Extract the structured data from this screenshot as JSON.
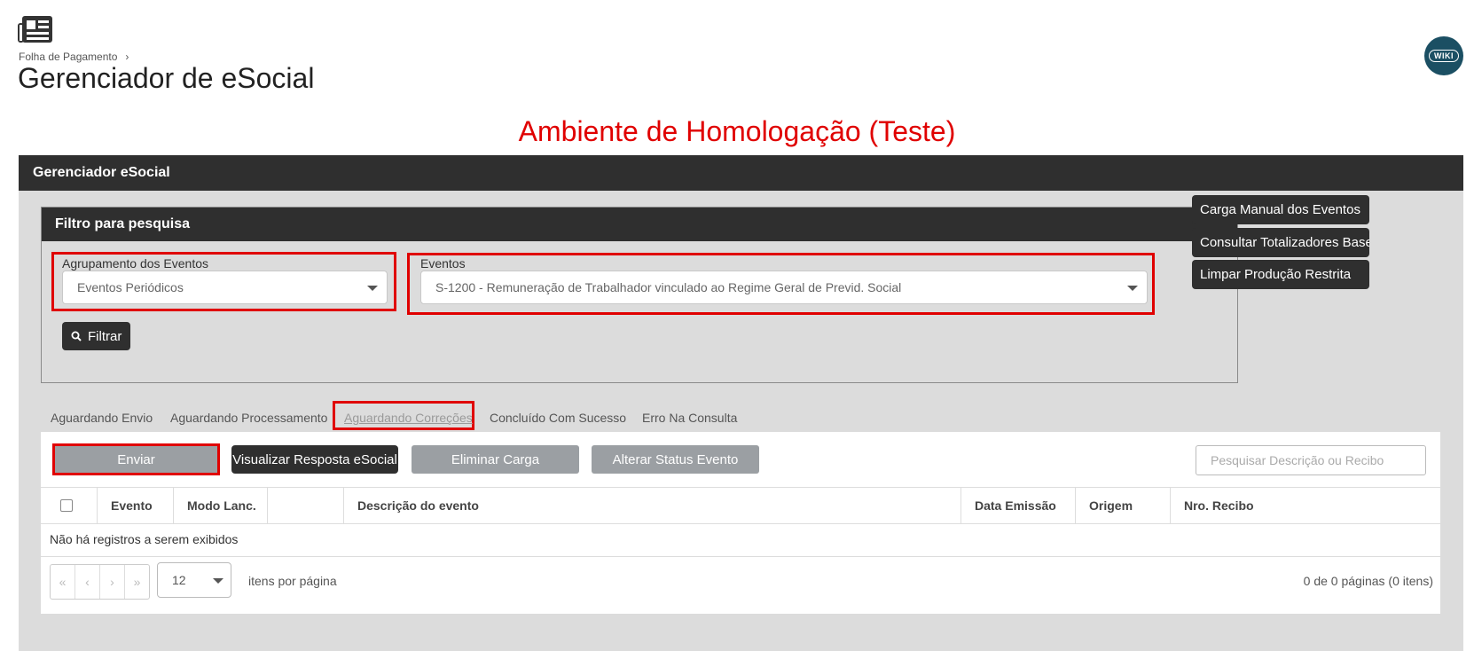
{
  "breadcrumb": {
    "parent": "Folha de Pagamento"
  },
  "page": {
    "title": "Gerenciador de eSocial",
    "wiki_label": "WIKI"
  },
  "environment_banner": "Ambiente de Homologação (Teste)",
  "panel": {
    "header": "Gerenciador eSocial"
  },
  "filter": {
    "header": "Filtro para pesquisa",
    "group_label": "Agrupamento dos Eventos",
    "group_value": "Eventos Periódicos",
    "events_label": "Eventos",
    "events_value": "S-1200 - Remuneração de Trabalhador vinculado ao Regime Geral de Previd. Social",
    "filter_button": "Filtrar"
  },
  "side_actions": [
    "Carga Manual dos Eventos",
    "Consultar Totalizadores Base",
    "Limpar Produção Restrita"
  ],
  "tabs": [
    "Aguardando Envio",
    "Aguardando Processamento",
    "Aguardando Correções",
    "Concluído Com Sucesso",
    "Erro Na Consulta"
  ],
  "toolbar": {
    "send": "Enviar",
    "view_response": "Visualizar Resposta eSocial",
    "remove_load": "Eliminar Carga",
    "change_status": "Alterar Status Evento",
    "search_placeholder": "Pesquisar Descrição ou Recibo"
  },
  "grid": {
    "columns": [
      "Evento",
      "Modo Lanc.",
      "",
      "Descrição do evento",
      "Data Emissão",
      "Origem",
      "Nro. Recibo"
    ],
    "empty_message": "Não há registros a serem exibidos",
    "page_size": "12",
    "per_page_label": "itens por página",
    "pager_info": "0 de 0 páginas (0 itens)"
  },
  "colors": {
    "highlight": "#e00000",
    "dark": "#2f2f2f",
    "panel_bg": "#dcdcdc"
  }
}
